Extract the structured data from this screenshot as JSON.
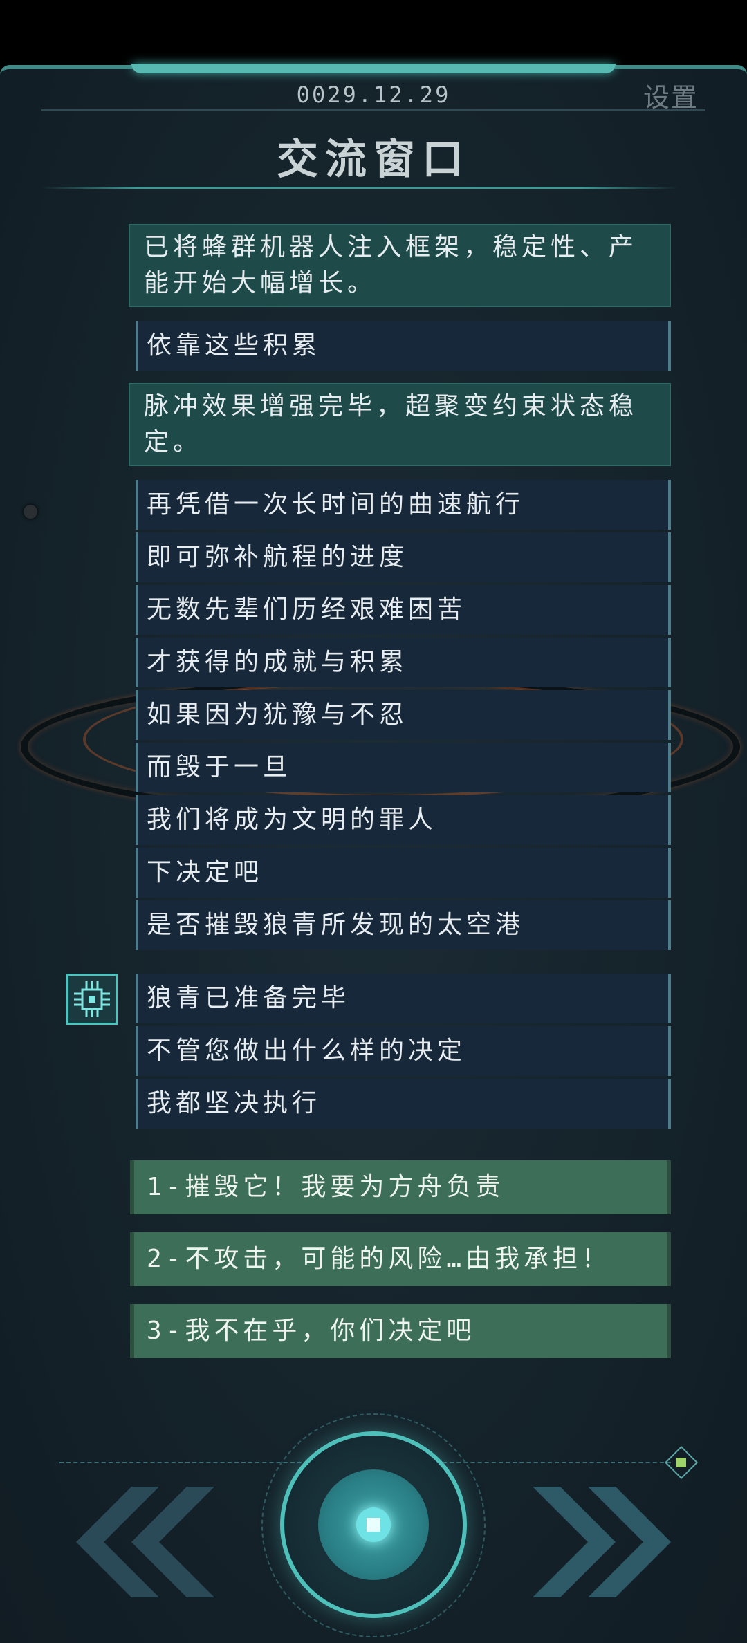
{
  "header": {
    "date": "0029.12.29",
    "settings_label": "设置",
    "title": "交流窗口"
  },
  "messages": [
    {
      "style": "teal",
      "text": "已将蜂群机器人注入框架，稳定性、产能开始大幅增长。"
    },
    {
      "style": "dark",
      "text": "依靠这些积累"
    },
    {
      "style": "teal",
      "text": "脉冲效果增强完毕，超聚变约束状态稳定。"
    },
    {
      "style": "dark",
      "text": "再凭借一次长时间的曲速航行"
    },
    {
      "style": "dark",
      "text": "即可弥补航程的进度"
    },
    {
      "style": "dark",
      "text": "无数先辈们历经艰难困苦"
    },
    {
      "style": "dark",
      "text": "才获得的成就与积累"
    },
    {
      "style": "dark",
      "text": "如果因为犹豫与不忍"
    },
    {
      "style": "dark",
      "text": "而毁于一旦"
    },
    {
      "style": "dark",
      "text": "我们将成为文明的罪人"
    },
    {
      "style": "dark",
      "text": "下决定吧"
    },
    {
      "style": "dark",
      "text": "是否摧毁狼青所发现的太空港"
    },
    {
      "style": "dark",
      "text": "狼青已准备完毕"
    },
    {
      "style": "dark",
      "text": "不管您做出什么样的决定"
    },
    {
      "style": "dark",
      "text": "我都坚决执行"
    }
  ],
  "options": [
    "1-摧毁它！我要为方舟负责",
    "2-不攻击，可能的风险…由我承担！",
    "3-我不在乎，你们决定吧"
  ],
  "icons": {
    "avatar": "robot-chip-icon",
    "prev": "double-chevron-left-icon",
    "next": "double-chevron-right-icon",
    "center": "confirm-button-icon"
  },
  "colors": {
    "teal_msg": "#1e4b49",
    "dark_msg": "#16283a",
    "option": "#3d6e57",
    "accent": "#4fbfba"
  }
}
